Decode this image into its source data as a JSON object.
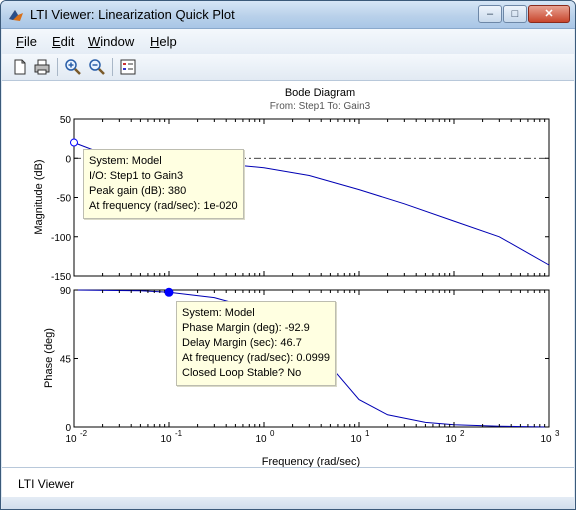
{
  "window": {
    "title": "LTI Viewer: Linearization Quick Plot"
  },
  "menu": [
    {
      "key": "F",
      "rest": "ile"
    },
    {
      "key": "E",
      "rest": "dit"
    },
    {
      "key": "W",
      "rest": "indow"
    },
    {
      "key": "H",
      "rest": "elp"
    }
  ],
  "toolbar": [
    "new-document-icon",
    "print-icon",
    "zoom-in-icon",
    "zoom-out-icon",
    "grid-legend-icon"
  ],
  "plot": {
    "title": "Bode Diagram",
    "subtitle": "From: Step1  To: Gain3",
    "xlabel": "Frequency  (rad/sec)",
    "magnitude_label": "Magnitude (dB)",
    "phase_label": "Phase (deg)"
  },
  "chart_data": [
    {
      "type": "line",
      "name": "magnitude",
      "x_scale": "log",
      "xlim": [
        0.01,
        1000
      ],
      "ylim": [
        -150,
        50
      ],
      "yticks": [
        50,
        0,
        -50,
        -100,
        -150
      ],
      "zero_line": 0,
      "grid": false,
      "x": [
        0.01,
        0.02,
        0.05,
        0.1,
        0.3,
        1,
        3,
        10,
        30,
        100,
        300,
        1000
      ],
      "y": [
        20,
        6,
        -1,
        -3,
        -6,
        -12,
        -22,
        -40,
        -58,
        -80,
        -100,
        -136
      ],
      "marker": {
        "x": 0.01,
        "y": 20
      }
    },
    {
      "type": "line",
      "name": "phase",
      "x_scale": "log",
      "xlim": [
        0.01,
        1000
      ],
      "ylim": [
        0,
        90
      ],
      "yticks": [
        90,
        45,
        0
      ],
      "grid": false,
      "x": [
        0.01,
        0.05,
        0.0999,
        0.3,
        1,
        2,
        3,
        5,
        10,
        20,
        50,
        100,
        300,
        1000
      ],
      "y": [
        90,
        89.5,
        88.5,
        85,
        76,
        66,
        56,
        40,
        18,
        8,
        3,
        1.5,
        0.5,
        0
      ],
      "marker": {
        "x": 0.0999,
        "y": 88.5
      }
    }
  ],
  "x_tick_bases": [
    "10",
    "10",
    "10",
    "10",
    "10",
    "10"
  ],
  "x_tick_exponents": [
    "-2",
    "-1",
    "0",
    "1",
    "2",
    "3"
  ],
  "tooltips": {
    "magnitude": {
      "line1": "System: Model",
      "line2": "I/O: Step1 to Gain3",
      "line3": "Peak gain (dB): 380",
      "line4": "At frequency (rad/sec): 1e-020"
    },
    "phase": {
      "line1": "System: Model",
      "line2": "Phase Margin (deg): -92.9",
      "line3": "Delay Margin (sec): 46.7",
      "line4": "At frequency (rad/sec): 0.0999",
      "line5": "Closed Loop Stable? No"
    }
  },
  "status": {
    "text": "LTI Viewer"
  },
  "colors": {
    "curve": "#0000b4",
    "marker": "#0000ff"
  }
}
